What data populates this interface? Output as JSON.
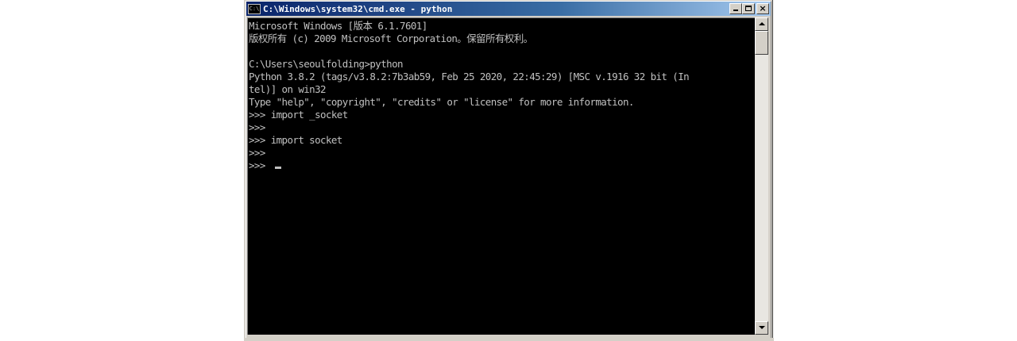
{
  "window": {
    "title": "C:\\Windows\\system32\\cmd.exe - python",
    "icon": "cmd-icon",
    "icon_text": "C:\\",
    "buttons": {
      "minimize": "minimize-icon",
      "maximize": "maximize-icon",
      "close": "close-icon",
      "close_glyph": "×"
    }
  },
  "console": {
    "lines": [
      "Microsoft Windows [版本 6.1.7601]",
      "版权所有 (c) 2009 Microsoft Corporation。保留所有权利。",
      "",
      "C:\\Users\\seoulfolding>python",
      "Python 3.8.2 (tags/v3.8.2:7b3ab59, Feb 25 2020, 22:45:29) [MSC v.1916 32 bit (In",
      "tel)] on win32",
      "Type \"help\", \"copyright\", \"credits\" or \"license\" for more information.",
      ">>> import _socket",
      ">>>",
      ">>> import socket",
      ">>>",
      ">>> "
    ],
    "text_color": "#c0c0c0",
    "background_color": "#000000"
  },
  "colors": {
    "title_start": "#0a246a",
    "title_end": "#a6caf0",
    "chrome": "#d4d0c8"
  }
}
